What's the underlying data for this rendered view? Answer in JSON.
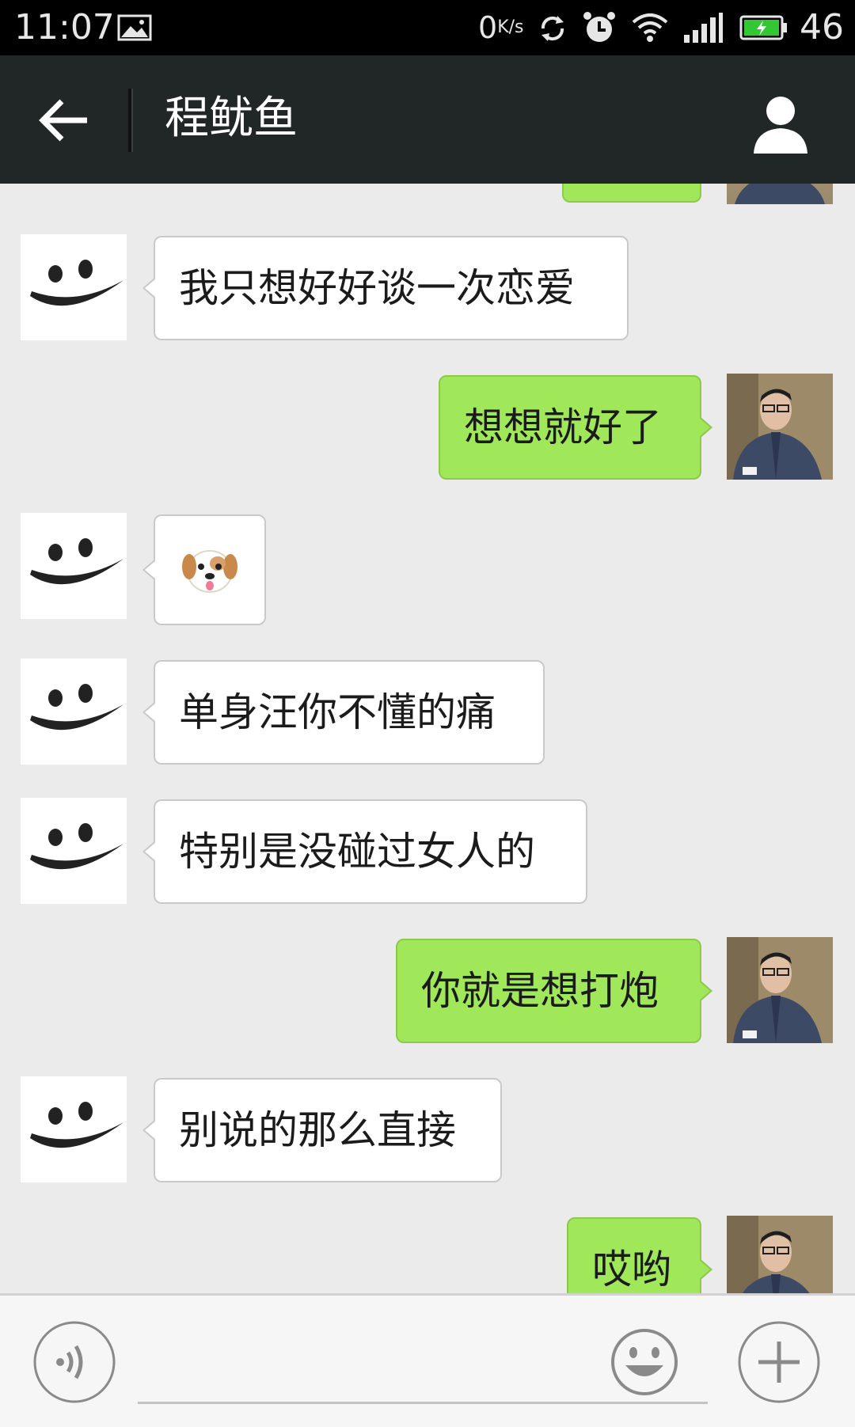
{
  "status_bar": {
    "time": "11:07",
    "net_speed": "0",
    "net_speed_unit": "K/s",
    "battery": "46",
    "icons": [
      "image-icon",
      "sync-icon",
      "alarm-icon",
      "wifi-icon",
      "signal-icon",
      "battery-icon"
    ]
  },
  "header": {
    "title": "程鱿鱼",
    "back_icon": "back-arrow-icon",
    "profile_icon": "person-icon"
  },
  "messages": [
    {
      "side": "in",
      "text": "我只想好好谈一次恋爱"
    },
    {
      "side": "out",
      "text": "想想就好了"
    },
    {
      "side": "in",
      "text": "🐶"
    },
    {
      "side": "in",
      "text": "单身汪你不懂的痛"
    },
    {
      "side": "in",
      "text": "特别是没碰过女人的"
    },
    {
      "side": "out",
      "text": "你就是想打炮"
    },
    {
      "side": "in",
      "text": "别说的那么直接"
    },
    {
      "side": "out",
      "text": "哎哟"
    }
  ],
  "input_bar": {
    "voice_icon": "voice-icon",
    "emoji_icon": "smiley-icon",
    "plus_icon": "plus-icon"
  },
  "colors": {
    "outgoing_bubble": "#a0e75a",
    "incoming_bubble": "#ffffff",
    "header_bg": "#212627",
    "chat_bg": "#ebebeb"
  }
}
